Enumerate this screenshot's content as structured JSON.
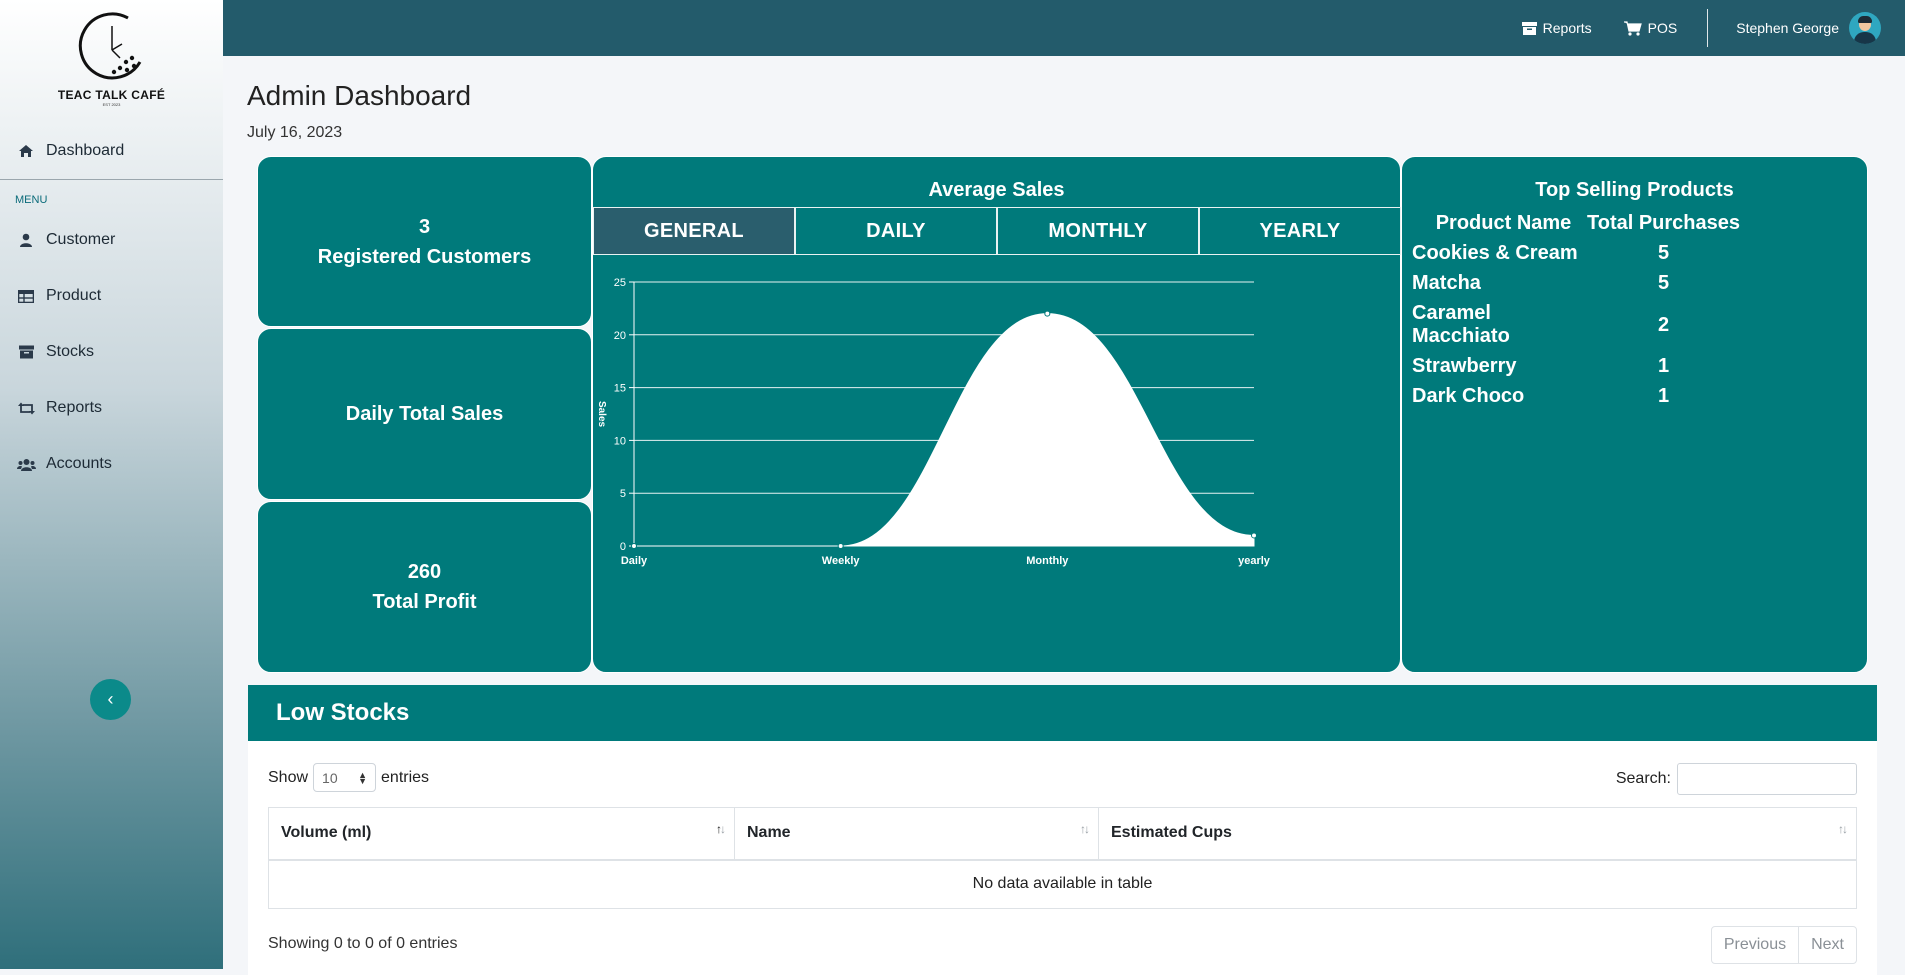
{
  "brand": {
    "name": "TEAC TALK CAFÉ",
    "sub": "EST 2023"
  },
  "sidebar": {
    "dashboard": "Dashboard",
    "menu_heading": "MENU",
    "items": [
      {
        "label": "Customer",
        "icon": "user-icon"
      },
      {
        "label": "Product",
        "icon": "table-icon"
      },
      {
        "label": "Stocks",
        "icon": "archive-icon"
      },
      {
        "label": "Reports",
        "icon": "retweet-icon"
      },
      {
        "label": "Accounts",
        "icon": "users-icon"
      }
    ],
    "collapse_icon": "‹"
  },
  "topbar": {
    "reports": "Reports",
    "pos": "POS",
    "user": "Stephen George"
  },
  "page": {
    "title": "Admin Dashboard",
    "date": "July 16, 2023"
  },
  "stats": {
    "customers_value": "3",
    "customers_label": "Registered Customers",
    "daily_label": "Daily Total Sales",
    "profit_value": "260",
    "profit_label": "Total Profit"
  },
  "sales": {
    "title": "Average Sales",
    "tabs": [
      "GENERAL",
      "DAILY",
      "MONTHLY",
      "YEARLY"
    ],
    "active_tab": 0
  },
  "chart_data": {
    "type": "area",
    "categories": [
      "Daily",
      "Weekly",
      "Monthly",
      "yearly"
    ],
    "values": [
      0,
      0,
      22,
      1
    ],
    "ylabel": "Sales",
    "ylim": [
      0,
      25
    ],
    "yticks": [
      0,
      5,
      10,
      15,
      20,
      25
    ],
    "grid": true,
    "colors": {
      "fill": "#ffffff",
      "axis": "#ffffff"
    }
  },
  "top_selling": {
    "title": "Top Selling Products",
    "headers": [
      "Product Name",
      "Total Purchases"
    ],
    "rows": [
      [
        "Cookies & Cream",
        "5"
      ],
      [
        "Matcha",
        "5"
      ],
      [
        "Caramel Macchiato",
        "2"
      ],
      [
        "Strawberry",
        "1"
      ],
      [
        "Dark Choco",
        "1"
      ]
    ]
  },
  "low_stocks": {
    "title": "Low Stocks",
    "show": "Show",
    "entries": "entries",
    "page_size": "10",
    "search_label": "Search:",
    "columns": [
      "Volume (ml)",
      "Name",
      "Estimated Cups"
    ],
    "empty": "No data available in table",
    "info": "Showing 0 to 0 of 0 entries",
    "previous": "Previous",
    "next": "Next"
  },
  "colors": {
    "teal": "#007a7b",
    "topbar": "#235b6b",
    "active_tab": "#2a5e6d"
  }
}
